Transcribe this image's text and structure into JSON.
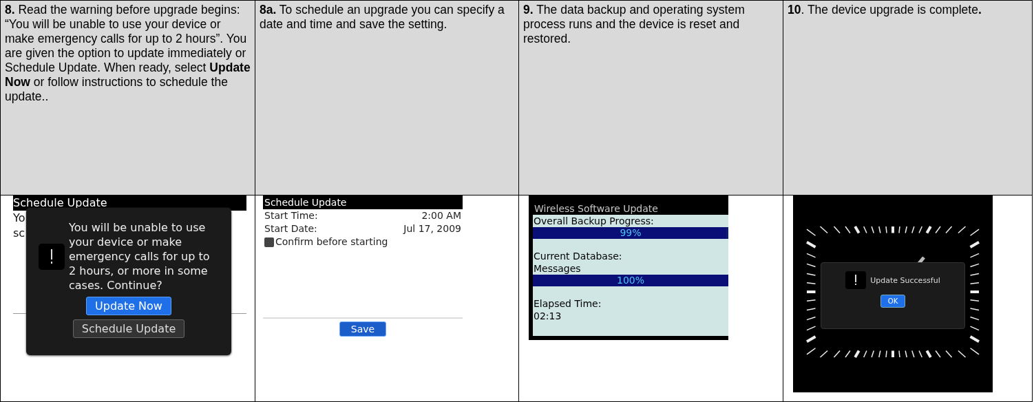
{
  "steps": [
    {
      "caption": "**8.** Read the warning before upgrade begins: “You will be unable to use your device or make emergency calls for up to 2 hours”. You are given the option to update immediately or Schedule Update. When ready, select **Update Now** or follow instructions to schedule the update..",
      "screen": {
        "kind": "warning",
        "title": "Schedule Update",
        "background_lines": [
          "Yo",
          "sc"
        ],
        "dialog": {
          "message": "You will be unable to use your device or make emergency calls for up to 2 hours, or more in some cases. Continue?",
          "buttons": [
            {
              "label": "Update Now",
              "selected": true
            },
            {
              "label": "Schedule Update",
              "selected": false
            }
          ]
        }
      }
    },
    {
      "caption": "**8a.**  To schedule an upgrade you can specify a date and time and save the setting.",
      "screen": {
        "kind": "schedule",
        "title": "Schedule Update",
        "fields": [
          {
            "label": "Start Time:",
            "value": "2:00 AM"
          },
          {
            "label": "Start Date:",
            "value": "Jul 17, 2009"
          }
        ],
        "checkbox": {
          "label": "Confirm before starting",
          "checked": false
        },
        "button": {
          "label": "Save",
          "selected": true
        }
      }
    },
    {
      "caption": "**9.** The data backup and operating system process runs and the device is reset and restored.",
      "screen": {
        "kind": "progress",
        "title": "Wireless Software Update",
        "sections": [
          {
            "label": "Overall Backup Progress:",
            "level": 0.99,
            "reading": "99%"
          },
          {
            "label": "Current Database:",
            "value": "Messages",
            "level": 1,
            "reading": "100%"
          }
        ],
        "elapsed_label": "Elapsed Time:",
        "elapsed": "02:13"
      }
    },
    {
      "caption": "**10**. The device upgrade is complete**.**",
      "screen": {
        "kind": "success",
        "message": "Update Successful",
        "button": {
          "label": "OK",
          "selected": true
        }
      }
    }
  ]
}
